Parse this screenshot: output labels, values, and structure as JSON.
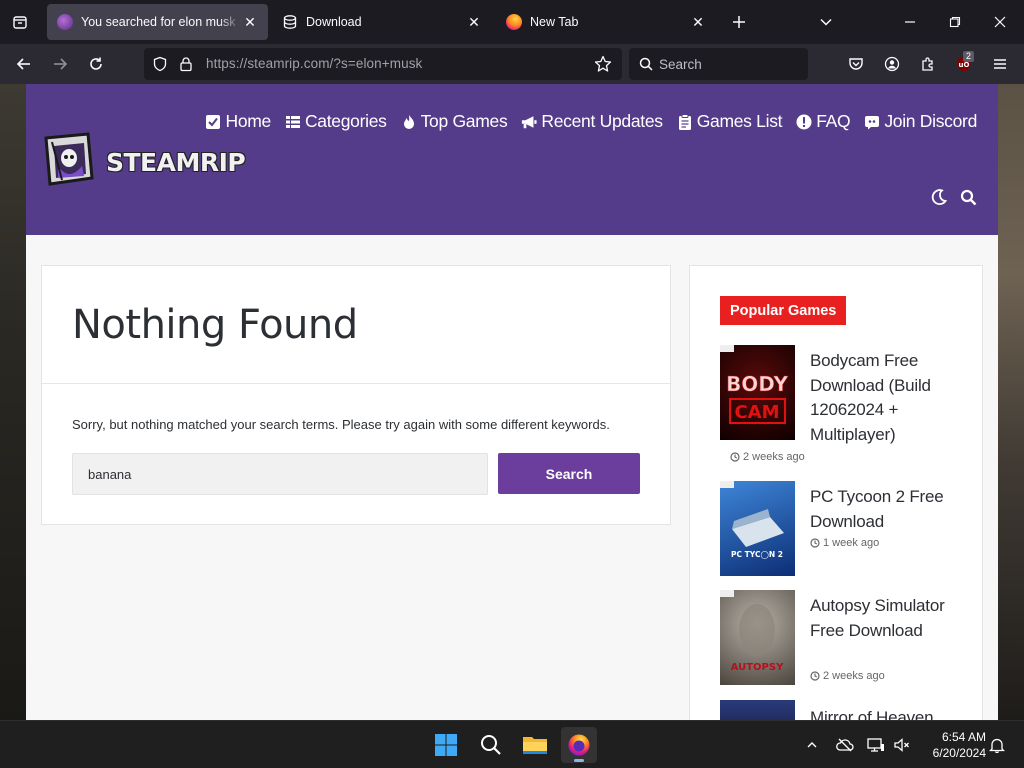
{
  "browser": {
    "tabs": [
      {
        "title": "You searched for elon musk » S",
        "active": true
      },
      {
        "title": "Download",
        "active": false
      },
      {
        "title": "New Tab",
        "active": false
      }
    ],
    "url_host": "https://steamrip.com",
    "url_path": "/?s=elon+musk",
    "search_placeholder": "Search",
    "extension_badge": "2"
  },
  "site": {
    "logo_text": "STEAMRIP",
    "nav": [
      {
        "label": "Home",
        "icon": "steam-icon"
      },
      {
        "label": "Categories",
        "icon": "list-icon"
      },
      {
        "label": "Top Games",
        "icon": "fire-icon"
      },
      {
        "label": "Recent Updates",
        "icon": "megaphone-icon"
      },
      {
        "label": "Games List",
        "icon": "clipboard-icon"
      },
      {
        "label": "FAQ",
        "icon": "info-icon"
      },
      {
        "label": "Join Discord",
        "icon": "discord-icon"
      }
    ]
  },
  "main": {
    "title": "Nothing Found",
    "message": "Sorry, but nothing matched your search terms. Please try again with some different keywords.",
    "search_value": "banana",
    "search_button": "Search"
  },
  "sidebar": {
    "widget_title": "Popular Games",
    "posts": [
      {
        "title": "Bodycam Free Download (Build 12062024 + Multiplayer)",
        "date": "2 weeks ago",
        "thumb_text": "BODY CAM"
      },
      {
        "title": "PC Tycoon 2 Free Download",
        "date": "1 week ago",
        "thumb_text": "PC TYCOON 2"
      },
      {
        "title": "Autopsy Simulator Free Download",
        "date": "2 weeks ago",
        "thumb_text": "AUTOPSY"
      },
      {
        "title": "Mirror of Heaven",
        "date": "",
        "thumb_text": ""
      }
    ]
  },
  "taskbar": {
    "time": "6:54 AM",
    "date": "6/20/2024"
  },
  "colors": {
    "header_purple": "#553c8b",
    "button_purple": "#6b3e9d",
    "widget_red": "#e8201f"
  }
}
